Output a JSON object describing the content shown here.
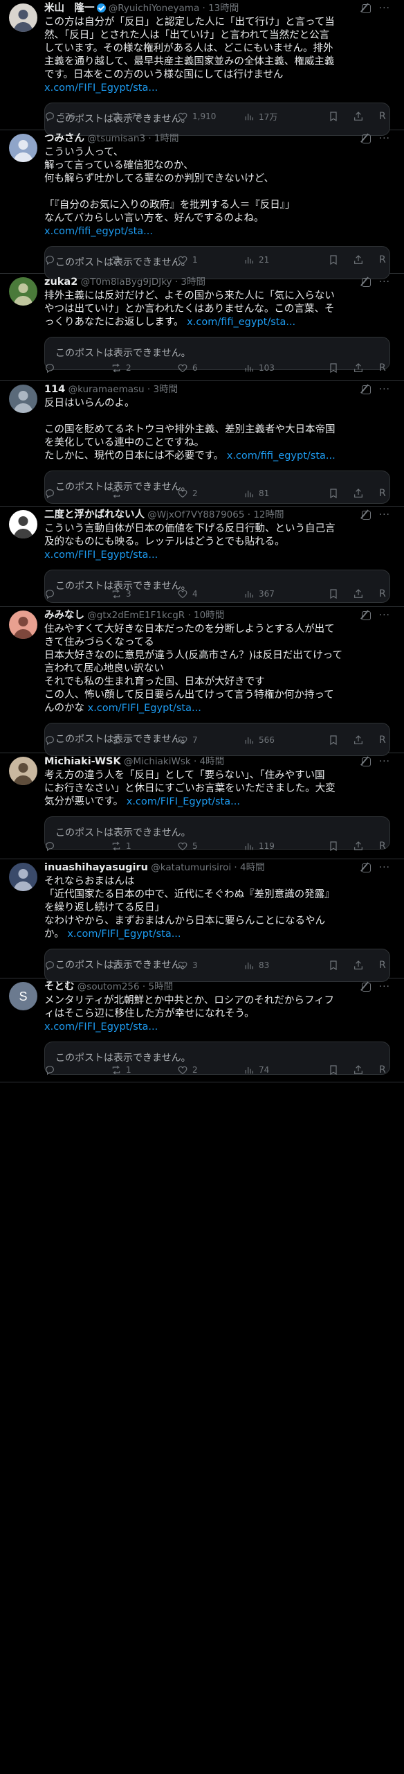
{
  "not_available_text": "このポストは表示できません。",
  "accent_color": "#1d9bf0",
  "tweets": [
    {
      "name": "米山　隆一",
      "verified": true,
      "handle": "@RyuichiYoneyama",
      "time": "13時間",
      "avatar": {
        "bg": "#d9d5cf",
        "fg": "#1b2a4a",
        "icon": "person-photo-icon"
      },
      "lines": [
        "この方は自分が「反日」と認定した人に「出て行け」と言って当",
        "然、「反日」とされた人は「出ていけ」と言われて当然だと公言",
        "しています。その様な権利がある人は、どこにもいません。排外",
        "主義を通り越して、最早共産主義国家並みの全体主義、権威主義",
        "です。日本をこの方のいう様な国にしては行けません"
      ],
      "link": "x.com/FIFI_Egypt/sta...",
      "link_inline": false,
      "replies": "576",
      "reposts": "472",
      "likes": "1,910",
      "views": "17万"
    },
    {
      "name": "つみさん",
      "verified": false,
      "handle": "@tsumisan3",
      "time": "1時間",
      "avatar": {
        "bg": "#8fa5c9",
        "fg": "#ffffff",
        "icon": "cloud-photo-icon"
      },
      "lines": [
        "こういう人って、",
        "解って言っている確信犯なのか、",
        "何も解らず吐かしてる輩なのか判別できないけど、",
        "",
        "「『自分のお気に入りの政府』を批判する人＝『反日』」",
        "なんてバカらしい言い方を、好んでするのよね。"
      ],
      "link": "x.com/fifi_egypt/sta...",
      "link_inline": false,
      "replies": "",
      "reposts": "",
      "likes": "1",
      "views": "21"
    },
    {
      "name": "zuka2",
      "verified": false,
      "handle": "@T0m8laByg9jDJky",
      "time": "3時間",
      "avatar": {
        "bg": "#4a7a3a",
        "fg": "#e8e0c0",
        "icon": "flower-photo-icon"
      },
      "lines": [
        "排外主義には反対だけど、よその国から来た人に「気に入らない",
        "やつは出ていけ」とか言われたくはありませんな。この言葉、そ",
        "っくりあなたにお返しします。"
      ],
      "link": "x.com/fifi_egypt/sta...",
      "link_inline": true,
      "replies": "",
      "reposts": "2",
      "likes": "6",
      "views": "103"
    },
    {
      "name": "114",
      "verified": false,
      "handle": "@kuramaemasu",
      "time": "3時間",
      "avatar": {
        "bg": "#5a6a7a",
        "fg": "#c8d2dc",
        "icon": "bird-photo-icon"
      },
      "lines": [
        "反日はいらんのよ。",
        "",
        "この国を貶めてるネトウヨや排外主義、差別主義者や大日本帝国",
        "を美化している連中のことですね。",
        "たしかに、現代の日本には不必要です。"
      ],
      "link": "x.com/fifi_egypt/sta...",
      "link_inline": true,
      "replies": "",
      "reposts": "",
      "likes": "2",
      "views": "81"
    },
    {
      "name": "二度と浮かばれない人",
      "verified": false,
      "handle": "@WjxOf7VY8879065",
      "time": "12時間",
      "avatar": {
        "bg": "#ffffff",
        "fg": "#000000",
        "icon": "pattern-photo-icon"
      },
      "lines": [
        "こういう言動自体が日本の価値を下げる反日行動、という自己言",
        "及的なものにも映る。レッテルはどうとでも貼れる。"
      ],
      "link": "x.com/FIFI_Egypt/sta...",
      "link_inline": false,
      "replies": "",
      "reposts": "3",
      "likes": "4",
      "views": "367"
    },
    {
      "name": "みみなし",
      "verified": false,
      "handle": "@gtx2dEmE1F1kcgR",
      "time": "10時間",
      "avatar": {
        "bg": "#e8a090",
        "fg": "#5a2a20",
        "icon": "character-photo-icon"
      },
      "lines": [
        "住みやすくて大好きな日本だったのを分断しようとする人が出て",
        "きて住みづらくなってる",
        "日本大好きなのに意見が違う人(反高市さん？)は反日だ出てけって",
        "言われて居心地良い訳ない",
        "それでも私の生まれ育った国、日本が大好きです",
        "この人、怖い顔して反日要らん出てけって言う特権か何か持って",
        "んのかな"
      ],
      "link": "x.com/FIFI_Egypt/sta...",
      "link_inline": true,
      "replies": "",
      "reposts": "3",
      "likes": "7",
      "views": "566"
    },
    {
      "name": "Michiaki-WSK",
      "verified": false,
      "handle": "@MichiakiWsk",
      "time": "4時間",
      "avatar": {
        "bg": "#c9b8a0",
        "fg": "#3a2a1a",
        "icon": "person-photo-icon"
      },
      "lines": [
        "考え方の違う人を「反日」として「要らない」、「住みやすい国",
        "にお行きなさい」と休日にすごいお言葉をいただきました。大変",
        "気分が悪いです。"
      ],
      "link": "x.com/FIFI_Egypt/sta...",
      "link_inline": true,
      "replies": "",
      "reposts": "1",
      "likes": "5",
      "views": "119"
    },
    {
      "name": "inuashihayasugiru",
      "verified": false,
      "handle": "@katatumurisiroi",
      "time": "4時間",
      "avatar": {
        "bg": "#3a4a6a",
        "fg": "#d0d8e8",
        "icon": "pattern-photo-icon"
      },
      "lines": [
        "それならおまはんは",
        "「近代国家たる日本の中で、近代にそぐわぬ『差別意識の発露』",
        "を繰り返し続けてる反日」",
        "なわけやから、まずおまはんから日本に要らんことになるやん",
        "か。"
      ],
      "link": "x.com/FIFI_Egypt/sta...",
      "link_inline": true,
      "replies": "",
      "reposts": "1",
      "likes": "3",
      "views": "83"
    },
    {
      "name": "そとむ",
      "verified": false,
      "handle": "@soutom256",
      "time": "5時間",
      "avatar": {
        "bg": "#6b7a8f",
        "fg": "#ffffff",
        "icon": "letter-s-avatar",
        "letter": "S"
      },
      "lines": [
        "メンタリティが北朝鮮とか中共とか、ロシアのそれだからフィフ",
        "ィはそこら辺に移住した方が幸せになれそう。"
      ],
      "link": "x.com/FIFI_Egypt/sta...",
      "link_inline": false,
      "replies": "",
      "reposts": "1",
      "likes": "2",
      "views": "74"
    }
  ]
}
